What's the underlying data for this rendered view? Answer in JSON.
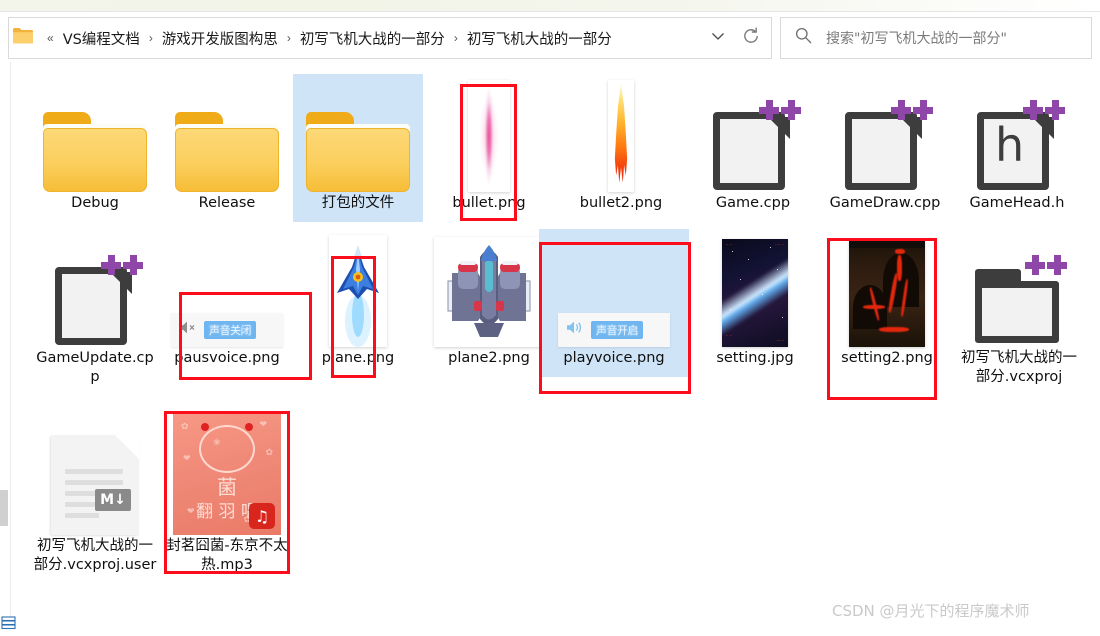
{
  "window": {
    "watermark": "CSDN @月光下的程序魔术师"
  },
  "addressbar": {
    "folder_icon": "folder-icon",
    "back_chevron": "«",
    "separator": "›",
    "crumbs": [
      {
        "label": "VS编程文档"
      },
      {
        "label": "游戏开发版图构思"
      },
      {
        "label": "初写飞机大战的一部分"
      },
      {
        "label": "初写飞机大战的一部分"
      }
    ],
    "dropdown_icon": "chevron-down-icon",
    "refresh_icon": "refresh-icon"
  },
  "search": {
    "icon": "search-icon",
    "placeholder": "搜索\"初写飞机大战的一部分\"",
    "value": ""
  },
  "statusbar": {
    "view_mode_icon": "list-view-icon"
  },
  "colors": {
    "annotation_red": "#fc0d1b",
    "selection_blue": "#cfe4f7",
    "folder_yellow": "#f6bd37",
    "cpp_purple": "#8e46a8",
    "watermark_grey": "#c9c9c9"
  },
  "files": [
    {
      "name": "Debug",
      "type": "folder",
      "selected": false,
      "annotated": false
    },
    {
      "name": "Release",
      "type": "folder",
      "selected": false,
      "annotated": false
    },
    {
      "name": "打包的文件",
      "type": "folder",
      "selected": true,
      "annotated": false
    },
    {
      "name": "bullet.png",
      "type": "image-pink-bullet",
      "selected": false,
      "annotated": true
    },
    {
      "name": "bullet2.png",
      "type": "image-flame-bullet",
      "selected": false,
      "annotated": false
    },
    {
      "name": "Game.cpp",
      "type": "cpp-source",
      "selected": false,
      "annotated": false
    },
    {
      "name": "GameDraw.cpp",
      "type": "cpp-source",
      "selected": false,
      "annotated": false
    },
    {
      "name": "GameHead.h",
      "type": "cpp-header",
      "selected": false,
      "annotated": false
    },
    {
      "name": "GameUpdate.cpp",
      "type": "cpp-source",
      "selected": false,
      "annotated": false
    },
    {
      "name": "pausvoice.png",
      "type": "voice-off",
      "selected": false,
      "annotated": true,
      "thumb_text": "声音关闭"
    },
    {
      "name": "plane.png",
      "type": "image-plane1",
      "selected": false,
      "annotated": true
    },
    {
      "name": "plane2.png",
      "type": "image-plane2",
      "selected": false,
      "annotated": false
    },
    {
      "name": "playvoice.png",
      "type": "voice-on",
      "selected": true,
      "annotated": true,
      "thumb_text": "声音开启"
    },
    {
      "name": "setting.jpg",
      "type": "image-space",
      "selected": false,
      "annotated": false
    },
    {
      "name": "setting2.png",
      "type": "image-lava",
      "selected": false,
      "annotated": true
    },
    {
      "name": "初写飞机大战的一部分.vcxproj",
      "type": "vcxproj",
      "selected": false,
      "annotated": false
    },
    {
      "name": "初写飞机大战的一部分.vcxproj.user",
      "type": "doc-md",
      "selected": false,
      "annotated": false
    },
    {
      "name": "封茗囧菌-东京不太热.mp3",
      "type": "audio-mp3",
      "selected": false,
      "annotated": true,
      "thumb_text": "菌 翻唱"
    }
  ]
}
